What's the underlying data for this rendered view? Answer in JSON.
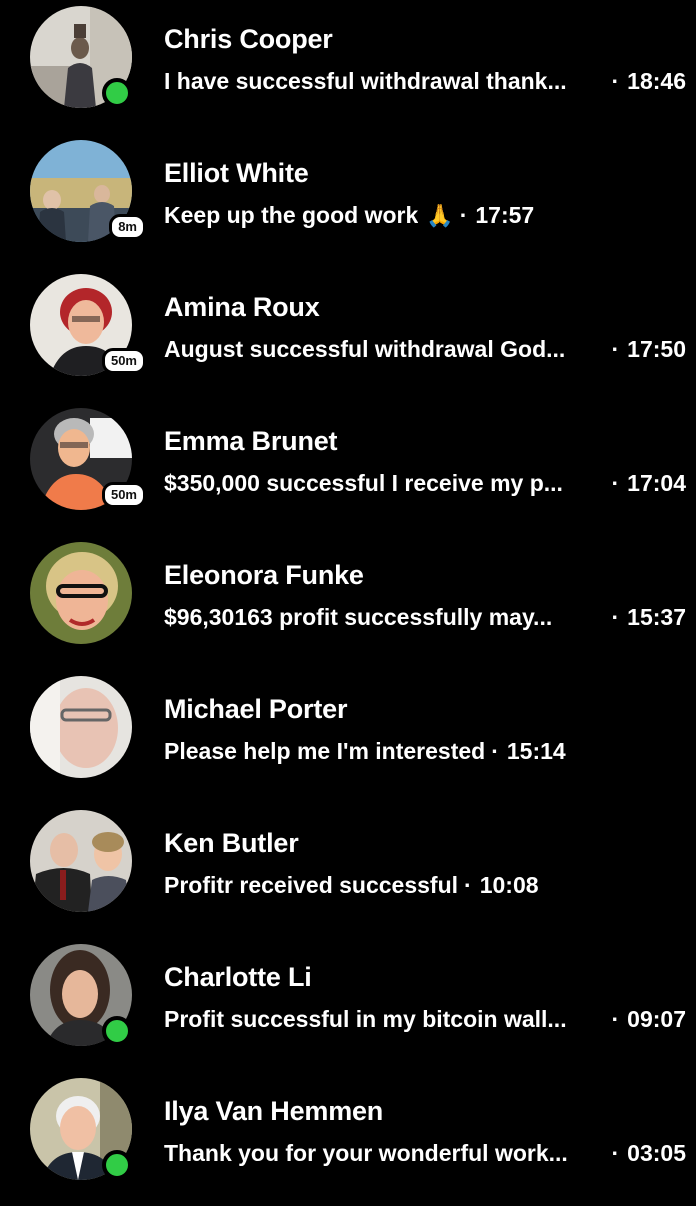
{
  "colors": {
    "background": "#000000",
    "text": "#ffffff",
    "online": "#31cc46",
    "badge_bg": "#ffffff"
  },
  "conversations": [
    {
      "name": "Chris Cooper",
      "message": "I have successful withdrawal thank...",
      "time": "18:46",
      "status": "online"
    },
    {
      "name": "Elliot White",
      "message": "Keep up the good work",
      "emoji": "🙏",
      "time": "17:57",
      "status_badge": "8m"
    },
    {
      "name": "Amina Roux",
      "message": "August successful withdrawal God...",
      "time": "17:50",
      "status_badge": "50m"
    },
    {
      "name": "Emma Brunet",
      "message": "$350,000 successful I receive my p...",
      "time": "17:04",
      "status_badge": "50m"
    },
    {
      "name": "Eleonora Funke",
      "message": "$96,30163 profit successfully may...",
      "time": "15:37"
    },
    {
      "name": "Michael Porter",
      "message": "Please help me I'm interested",
      "time": "15:14"
    },
    {
      "name": "Ken Butler",
      "message": "Profitr received successful",
      "time": "10:08"
    },
    {
      "name": "Charlotte Li",
      "message": "Profit successful in my bitcoin wall...",
      "time": "09:07",
      "status": "online"
    },
    {
      "name": "Ilya Van Hemmen",
      "message": "Thank you for your wonderful work...",
      "time": "03:05",
      "status": "online"
    }
  ]
}
